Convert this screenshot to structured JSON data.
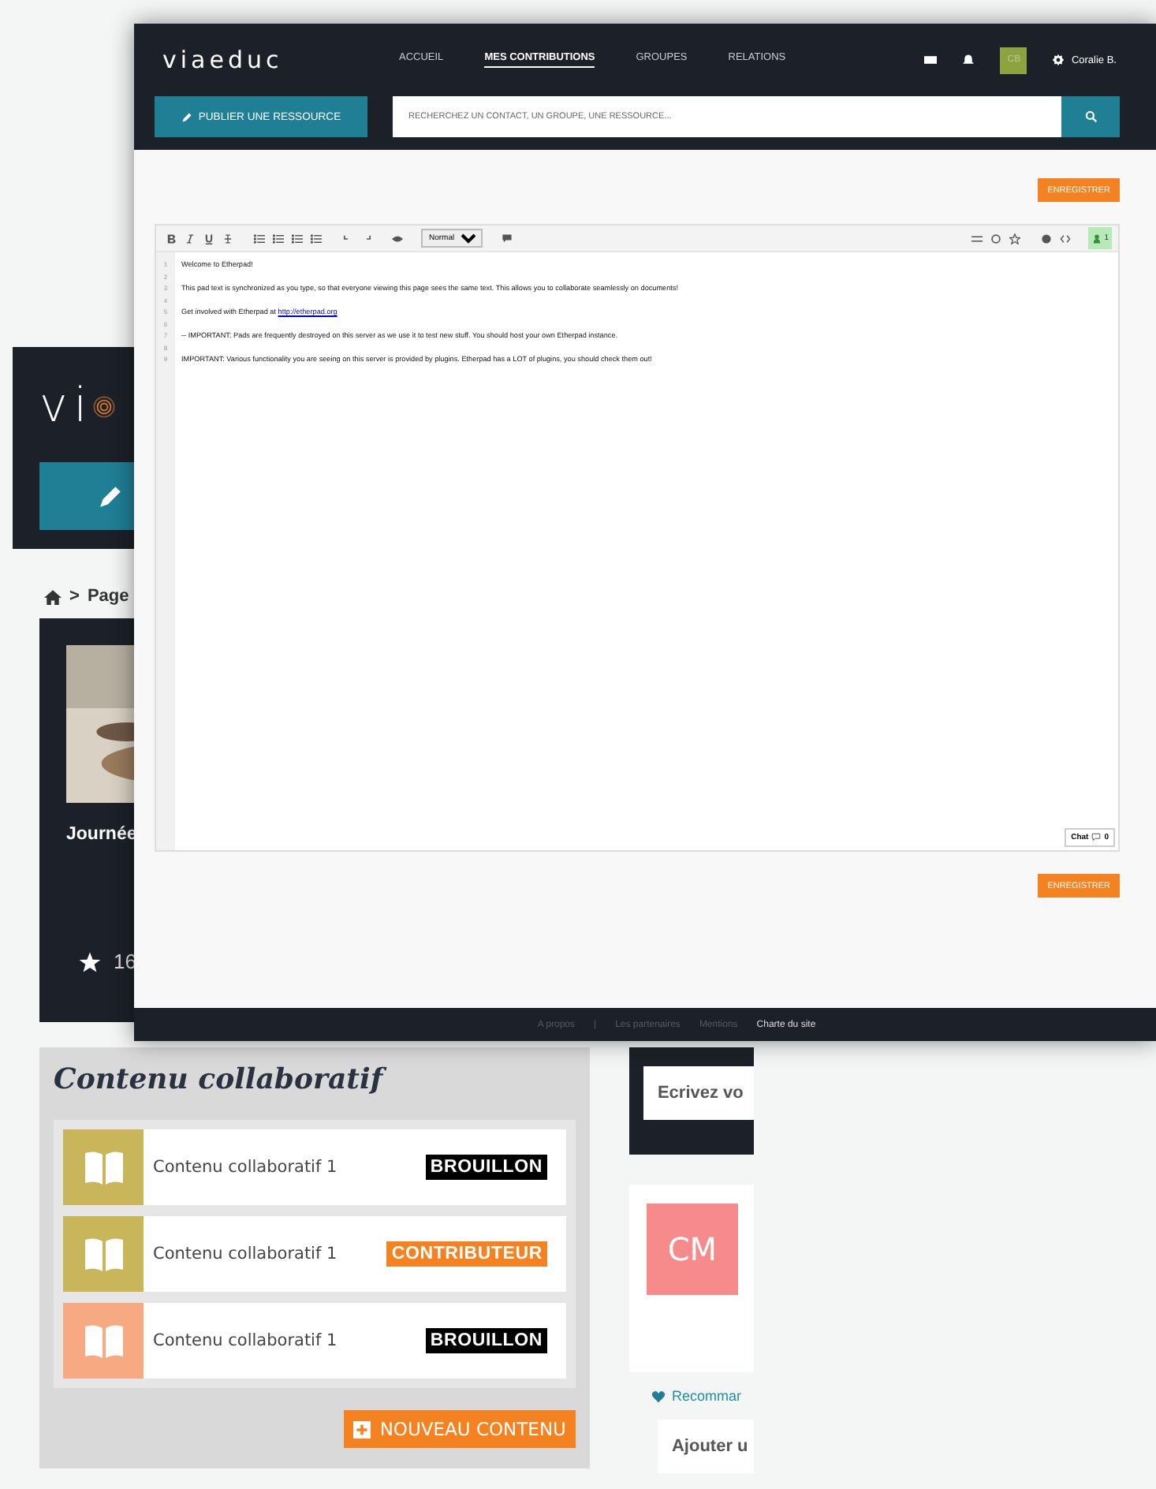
{
  "back_page": {
    "logo": "vi",
    "breadcrumb": {
      "separator": ">",
      "current": "Page"
    },
    "card": {
      "kind": "picture",
      "title": "Journée",
      "rating": "16"
    },
    "collab_panel": {
      "title": "Contenu collaboratif",
      "items": [
        {
          "name": "Contenu collaboratif 1",
          "color": "#c9b65a",
          "status": "BROUILLON",
          "kind": "draft"
        },
        {
          "name": "Contenu collaboratif 1",
          "color": "#c9b65a",
          "status": "CONTRIBUTEUR",
          "kind": "contributor"
        },
        {
          "name": "Contenu collaboratif 1",
          "color": "#f7a982",
          "status": "BROUILLON",
          "kind": "draft"
        }
      ],
      "new_button": "NOUVEAU CONTENU"
    },
    "sidebar": {
      "comment_placeholder": "Ecrivez vo",
      "avatar": "CM",
      "recommend_link": "Recommar",
      "add_placeholder": "Ajouter u"
    }
  },
  "window": {
    "logo": "viaeduc",
    "nav": [
      {
        "label": "ACCUEIL",
        "selected": false
      },
      {
        "label": "MES CONTRIBUTIONS",
        "selected": true
      },
      {
        "label": "GROUPES",
        "selected": false
      },
      {
        "label": "RELATIONS",
        "selected": false
      }
    ],
    "user": {
      "initials": "CB",
      "name": "Coralie B."
    },
    "publish_button": "PUBLIER UNE RESSOURCE",
    "search_placeholder": "RECHERCHEZ UN CONTACT, UN GROUPE, UNE RESSOURCE...",
    "save_buttons": [
      "ENREGISTRER",
      "ENREGISTRER"
    ],
    "editor": {
      "style_select": "Normal",
      "users_count": "1",
      "chat_label": "Chat",
      "chat_count": "0",
      "lines": [
        {
          "number": "1",
          "text": "Welcome to Etherpad!"
        },
        {
          "number": "2"
        },
        {
          "number": "3",
          "text": "This pad text is synchronized as you type, so that everyone viewing this page sees the same text. This allows you to collaborate seamlessly on documents!"
        },
        {
          "number": "4"
        },
        {
          "number": "5",
          "text": "Get involved with Etherpad at ",
          "link": "http://etherpad.org"
        },
        {
          "number": "6"
        },
        {
          "number": "7",
          "text": "-- IMPORTANT: Pads are frequently destroyed on this server as we use it to test new stuff. You should host your own Etherpad instance."
        },
        {
          "number": "8"
        },
        {
          "number": "9",
          "text": "IMPORTANT: Various functionality you are seeing on this server is provided by plugins. Etherpad has a LOT of plugins, you should check them out!"
        }
      ]
    },
    "footer": [
      {
        "label": "A propos",
        "active": false
      },
      {
        "label": "|",
        "active": false
      },
      {
        "label": "Les partenaires",
        "active": false
      },
      {
        "label": "Mentions",
        "active": false
      },
      {
        "label": "Charte du site",
        "active": true
      }
    ]
  }
}
